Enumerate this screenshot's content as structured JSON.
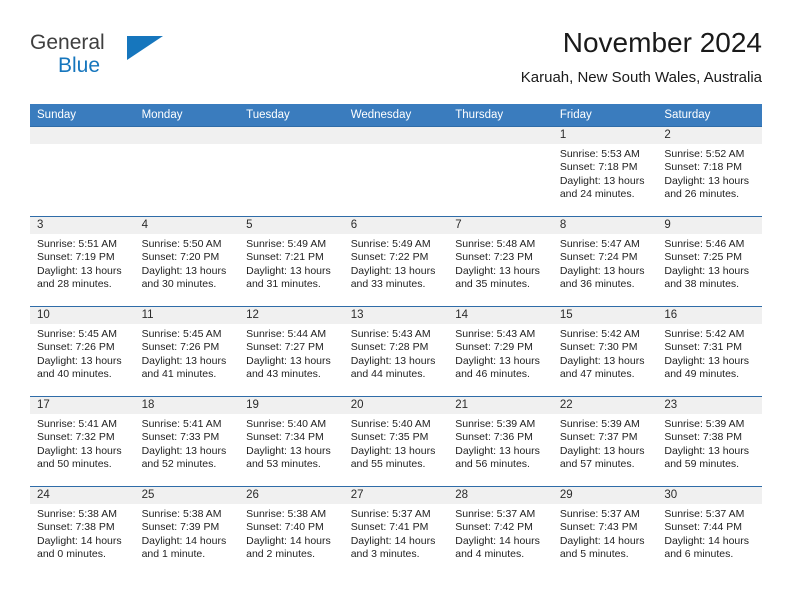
{
  "brand": {
    "word_one": "General",
    "word_two": "Blue",
    "triangle_icon": "triangle-logo-icon",
    "accent_color": "#1676bd"
  },
  "header": {
    "month_title": "November 2024",
    "location": "Karuah, New South Wales, Australia"
  },
  "calendar": {
    "header_bg": "#3a7cbe",
    "daynum_bg": "#f0f0f0",
    "weekday_headers": [
      "Sunday",
      "Monday",
      "Tuesday",
      "Wednesday",
      "Thursday",
      "Friday",
      "Saturday"
    ],
    "weeks": [
      [
        {
          "day": "",
          "sunrise": "",
          "sunset": "",
          "daylight_1": "",
          "daylight_2": ""
        },
        {
          "day": "",
          "sunrise": "",
          "sunset": "",
          "daylight_1": "",
          "daylight_2": ""
        },
        {
          "day": "",
          "sunrise": "",
          "sunset": "",
          "daylight_1": "",
          "daylight_2": ""
        },
        {
          "day": "",
          "sunrise": "",
          "sunset": "",
          "daylight_1": "",
          "daylight_2": ""
        },
        {
          "day": "",
          "sunrise": "",
          "sunset": "",
          "daylight_1": "",
          "daylight_2": ""
        },
        {
          "day": "1",
          "sunrise": "Sunrise: 5:53 AM",
          "sunset": "Sunset: 7:18 PM",
          "daylight_1": "Daylight: 13 hours",
          "daylight_2": "and 24 minutes."
        },
        {
          "day": "2",
          "sunrise": "Sunrise: 5:52 AM",
          "sunset": "Sunset: 7:18 PM",
          "daylight_1": "Daylight: 13 hours",
          "daylight_2": "and 26 minutes."
        }
      ],
      [
        {
          "day": "3",
          "sunrise": "Sunrise: 5:51 AM",
          "sunset": "Sunset: 7:19 PM",
          "daylight_1": "Daylight: 13 hours",
          "daylight_2": "and 28 minutes."
        },
        {
          "day": "4",
          "sunrise": "Sunrise: 5:50 AM",
          "sunset": "Sunset: 7:20 PM",
          "daylight_1": "Daylight: 13 hours",
          "daylight_2": "and 30 minutes."
        },
        {
          "day": "5",
          "sunrise": "Sunrise: 5:49 AM",
          "sunset": "Sunset: 7:21 PM",
          "daylight_1": "Daylight: 13 hours",
          "daylight_2": "and 31 minutes."
        },
        {
          "day": "6",
          "sunrise": "Sunrise: 5:49 AM",
          "sunset": "Sunset: 7:22 PM",
          "daylight_1": "Daylight: 13 hours",
          "daylight_2": "and 33 minutes."
        },
        {
          "day": "7",
          "sunrise": "Sunrise: 5:48 AM",
          "sunset": "Sunset: 7:23 PM",
          "daylight_1": "Daylight: 13 hours",
          "daylight_2": "and 35 minutes."
        },
        {
          "day": "8",
          "sunrise": "Sunrise: 5:47 AM",
          "sunset": "Sunset: 7:24 PM",
          "daylight_1": "Daylight: 13 hours",
          "daylight_2": "and 36 minutes."
        },
        {
          "day": "9",
          "sunrise": "Sunrise: 5:46 AM",
          "sunset": "Sunset: 7:25 PM",
          "daylight_1": "Daylight: 13 hours",
          "daylight_2": "and 38 minutes."
        }
      ],
      [
        {
          "day": "10",
          "sunrise": "Sunrise: 5:45 AM",
          "sunset": "Sunset: 7:26 PM",
          "daylight_1": "Daylight: 13 hours",
          "daylight_2": "and 40 minutes."
        },
        {
          "day": "11",
          "sunrise": "Sunrise: 5:45 AM",
          "sunset": "Sunset: 7:26 PM",
          "daylight_1": "Daylight: 13 hours",
          "daylight_2": "and 41 minutes."
        },
        {
          "day": "12",
          "sunrise": "Sunrise: 5:44 AM",
          "sunset": "Sunset: 7:27 PM",
          "daylight_1": "Daylight: 13 hours",
          "daylight_2": "and 43 minutes."
        },
        {
          "day": "13",
          "sunrise": "Sunrise: 5:43 AM",
          "sunset": "Sunset: 7:28 PM",
          "daylight_1": "Daylight: 13 hours",
          "daylight_2": "and 44 minutes."
        },
        {
          "day": "14",
          "sunrise": "Sunrise: 5:43 AM",
          "sunset": "Sunset: 7:29 PM",
          "daylight_1": "Daylight: 13 hours",
          "daylight_2": "and 46 minutes."
        },
        {
          "day": "15",
          "sunrise": "Sunrise: 5:42 AM",
          "sunset": "Sunset: 7:30 PM",
          "daylight_1": "Daylight: 13 hours",
          "daylight_2": "and 47 minutes."
        },
        {
          "day": "16",
          "sunrise": "Sunrise: 5:42 AM",
          "sunset": "Sunset: 7:31 PM",
          "daylight_1": "Daylight: 13 hours",
          "daylight_2": "and 49 minutes."
        }
      ],
      [
        {
          "day": "17",
          "sunrise": "Sunrise: 5:41 AM",
          "sunset": "Sunset: 7:32 PM",
          "daylight_1": "Daylight: 13 hours",
          "daylight_2": "and 50 minutes."
        },
        {
          "day": "18",
          "sunrise": "Sunrise: 5:41 AM",
          "sunset": "Sunset: 7:33 PM",
          "daylight_1": "Daylight: 13 hours",
          "daylight_2": "and 52 minutes."
        },
        {
          "day": "19",
          "sunrise": "Sunrise: 5:40 AM",
          "sunset": "Sunset: 7:34 PM",
          "daylight_1": "Daylight: 13 hours",
          "daylight_2": "and 53 minutes."
        },
        {
          "day": "20",
          "sunrise": "Sunrise: 5:40 AM",
          "sunset": "Sunset: 7:35 PM",
          "daylight_1": "Daylight: 13 hours",
          "daylight_2": "and 55 minutes."
        },
        {
          "day": "21",
          "sunrise": "Sunrise: 5:39 AM",
          "sunset": "Sunset: 7:36 PM",
          "daylight_1": "Daylight: 13 hours",
          "daylight_2": "and 56 minutes."
        },
        {
          "day": "22",
          "sunrise": "Sunrise: 5:39 AM",
          "sunset": "Sunset: 7:37 PM",
          "daylight_1": "Daylight: 13 hours",
          "daylight_2": "and 57 minutes."
        },
        {
          "day": "23",
          "sunrise": "Sunrise: 5:39 AM",
          "sunset": "Sunset: 7:38 PM",
          "daylight_1": "Daylight: 13 hours",
          "daylight_2": "and 59 minutes."
        }
      ],
      [
        {
          "day": "24",
          "sunrise": "Sunrise: 5:38 AM",
          "sunset": "Sunset: 7:38 PM",
          "daylight_1": "Daylight: 14 hours",
          "daylight_2": "and 0 minutes."
        },
        {
          "day": "25",
          "sunrise": "Sunrise: 5:38 AM",
          "sunset": "Sunset: 7:39 PM",
          "daylight_1": "Daylight: 14 hours",
          "daylight_2": "and 1 minute."
        },
        {
          "day": "26",
          "sunrise": "Sunrise: 5:38 AM",
          "sunset": "Sunset: 7:40 PM",
          "daylight_1": "Daylight: 14 hours",
          "daylight_2": "and 2 minutes."
        },
        {
          "day": "27",
          "sunrise": "Sunrise: 5:37 AM",
          "sunset": "Sunset: 7:41 PM",
          "daylight_1": "Daylight: 14 hours",
          "daylight_2": "and 3 minutes."
        },
        {
          "day": "28",
          "sunrise": "Sunrise: 5:37 AM",
          "sunset": "Sunset: 7:42 PM",
          "daylight_1": "Daylight: 14 hours",
          "daylight_2": "and 4 minutes."
        },
        {
          "day": "29",
          "sunrise": "Sunrise: 5:37 AM",
          "sunset": "Sunset: 7:43 PM",
          "daylight_1": "Daylight: 14 hours",
          "daylight_2": "and 5 minutes."
        },
        {
          "day": "30",
          "sunrise": "Sunrise: 5:37 AM",
          "sunset": "Sunset: 7:44 PM",
          "daylight_1": "Daylight: 14 hours",
          "daylight_2": "and 6 minutes."
        }
      ]
    ]
  }
}
